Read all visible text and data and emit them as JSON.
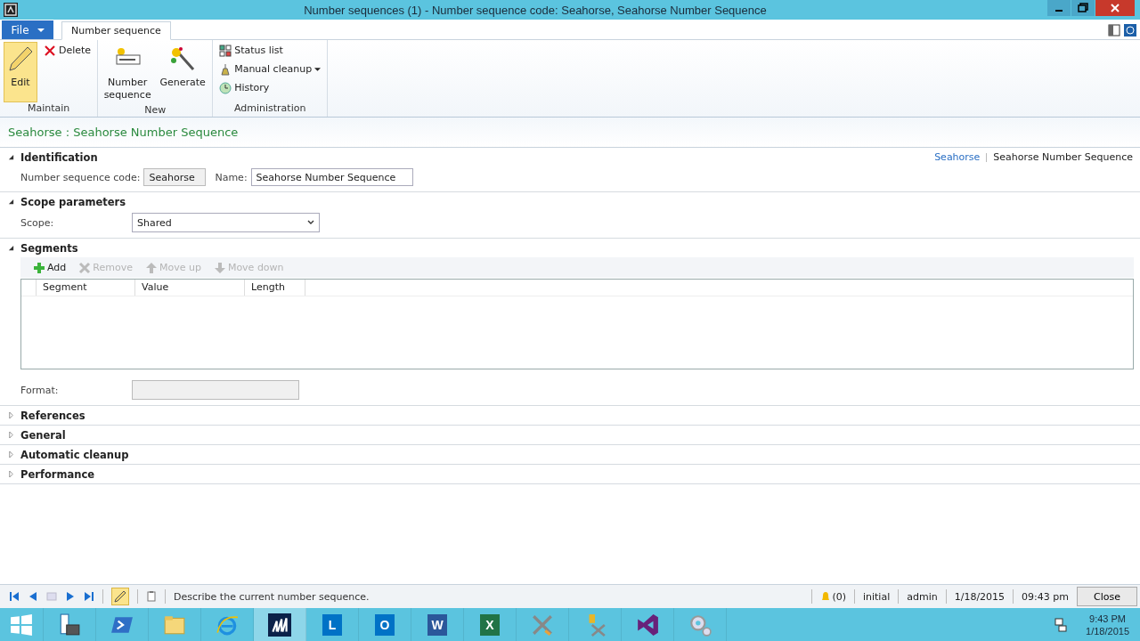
{
  "window": {
    "title": "Number sequences (1) - Number sequence code: Seahorse, Seahorse Number Sequence"
  },
  "ribbon": {
    "file_label": "File",
    "tabs": [
      {
        "label": "Number sequence",
        "selected": true
      }
    ],
    "groups": [
      {
        "label": "Maintain",
        "items": [
          {
            "kind": "edit",
            "label": "Edit",
            "selected": true
          },
          {
            "kind": "delete",
            "label": "Delete",
            "selected": false
          }
        ]
      },
      {
        "label": "New",
        "items": [
          {
            "kind": "numseq",
            "label": "Number sequence",
            "selected": false
          },
          {
            "kind": "generate",
            "label": "Generate",
            "selected": false
          }
        ]
      },
      {
        "label": "Administration",
        "items": [
          {
            "kind": "status",
            "label": "Status list",
            "selected": false
          },
          {
            "kind": "cleanup",
            "label": "Manual cleanup",
            "selected": false,
            "dropdown": true
          },
          {
            "kind": "history",
            "label": "History",
            "selected": false
          }
        ]
      }
    ]
  },
  "form_title": "Seahorse : Seahorse Number Sequence",
  "sections": [
    {
      "kind": "identification",
      "title": "Identification",
      "expanded": true,
      "breadcrumb": [
        "Seahorse",
        "Seahorse Number Sequence"
      ],
      "code_label": "Number sequence code:",
      "code_value": "Seahorse",
      "name_label": "Name:",
      "name_value": "Seahorse Number Sequence"
    },
    {
      "kind": "scope",
      "title": "Scope parameters",
      "expanded": true,
      "scope_label": "Scope:",
      "scope_value": "Shared"
    },
    {
      "kind": "segments",
      "title": "Segments",
      "expanded": true,
      "toolbar": [
        {
          "kind": "add",
          "label": "Add",
          "disabled": false
        },
        {
          "kind": "remove",
          "label": "Remove",
          "disabled": true
        },
        {
          "kind": "up",
          "label": "Move up",
          "disabled": true
        },
        {
          "kind": "down",
          "label": "Move down",
          "disabled": true
        }
      ],
      "columns": [
        "Segment",
        "Value",
        "Length"
      ],
      "format_label": "Format:"
    },
    {
      "kind": "plain",
      "title": "References",
      "expanded": false
    },
    {
      "kind": "plain",
      "title": "General",
      "expanded": false
    },
    {
      "kind": "plain",
      "title": "Automatic cleanup",
      "expanded": false
    },
    {
      "kind": "plain",
      "title": "Performance",
      "expanded": false
    }
  ],
  "status_bar": {
    "edit_on": true,
    "message": "Describe the current number sequence.",
    "alerts": "(0)",
    "fields": [
      "initial",
      "admin",
      "1/18/2015",
      "09:43 pm"
    ],
    "close": "Close"
  },
  "taskbar": {
    "items": [
      {
        "kind": "start",
        "selected": false
      },
      {
        "kind": "server",
        "selected": false
      },
      {
        "kind": "shell",
        "selected": false
      },
      {
        "kind": "folder",
        "selected": false
      },
      {
        "kind": "ie",
        "selected": false
      },
      {
        "kind": "dynamics",
        "selected": true
      },
      {
        "kind": "lync",
        "letter": "L",
        "selected": false
      },
      {
        "kind": "outlook",
        "letter": "O",
        "selected": false
      },
      {
        "kind": "word",
        "letter": "W",
        "selected": false
      },
      {
        "kind": "excel",
        "letter": "X",
        "selected": false
      },
      {
        "kind": "tools",
        "selected": false
      },
      {
        "kind": "dbtools",
        "selected": false
      },
      {
        "kind": "vs",
        "selected": false
      },
      {
        "kind": "gears",
        "selected": false
      }
    ],
    "time": "9:43 PM",
    "date": "1/18/2015"
  }
}
